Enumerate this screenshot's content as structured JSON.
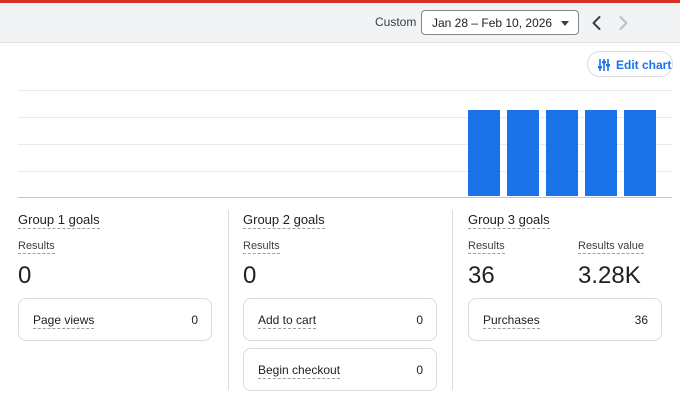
{
  "colors": {
    "accent_bar": "#d93025",
    "series_bar": "#1a73e8",
    "link": "#1a73e8"
  },
  "header": {
    "range_label": "Custom",
    "date_range": "Jan 28 – Feb 10, 2026",
    "prev_icon": "chevron-left-icon",
    "next_icon": "chevron-right-icon"
  },
  "toolbar": {
    "edit_chart_label": "Edit chart",
    "edit_chart_icon": "tune-sliders-icon"
  },
  "chart_data": {
    "type": "bar",
    "grid": true,
    "series": [
      {
        "values": [
          1,
          1,
          1,
          1,
          1
        ]
      }
    ]
  },
  "groups": [
    {
      "title": "Group 1 goals",
      "metrics": [
        {
          "label": "Results",
          "value": "0"
        }
      ],
      "events": [
        {
          "name": "Page views",
          "count": "0"
        }
      ]
    },
    {
      "title": "Group 2 goals",
      "metrics": [
        {
          "label": "Results",
          "value": "0"
        }
      ],
      "events": [
        {
          "name": "Add to cart",
          "count": "0"
        },
        {
          "name": "Begin checkout",
          "count": "0"
        }
      ]
    },
    {
      "title": "Group 3 goals",
      "metrics": [
        {
          "label": "Results",
          "value": "36"
        },
        {
          "label": "Results value",
          "value": "3.28K"
        }
      ],
      "events": [
        {
          "name": "Purchases",
          "count": "36"
        }
      ]
    }
  ]
}
